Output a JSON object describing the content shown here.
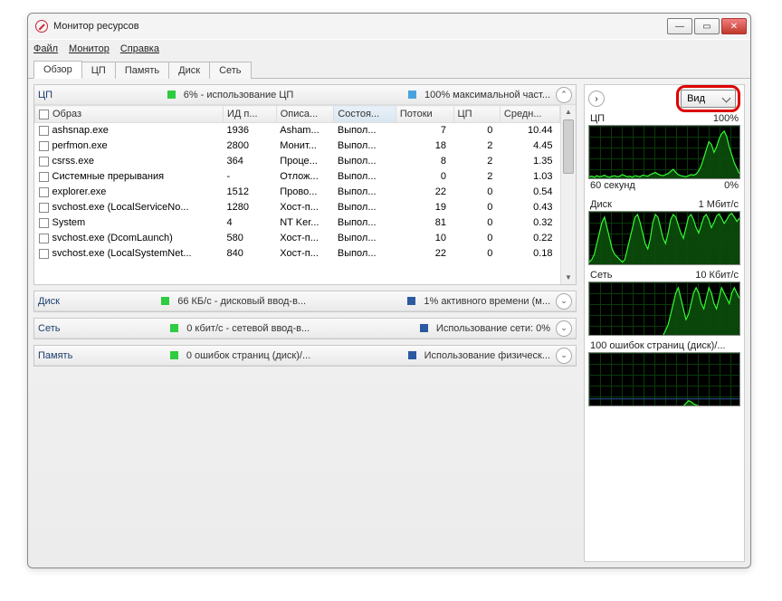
{
  "window": {
    "title": "Монитор ресурсов"
  },
  "menu": {
    "file": "Файл",
    "monitor": "Монитор",
    "help": "Справка"
  },
  "tabs": [
    "Обзор",
    "ЦП",
    "Память",
    "Диск",
    "Сеть"
  ],
  "active_tab": 0,
  "cpu_section": {
    "title": "ЦП",
    "stat1": "6% - использование ЦП",
    "stat2": "100% максимальной част...",
    "columns": [
      "Образ",
      "ИД п...",
      "Описа...",
      "Состоя...",
      "Потоки",
      "ЦП",
      "Средн..."
    ],
    "rows": [
      {
        "name": "ashsnap.exe",
        "pid": "1936",
        "desc": "Asham...",
        "state": "Выпол...",
        "threads": 7,
        "cpu": 0,
        "avg": "10.44"
      },
      {
        "name": "perfmon.exe",
        "pid": "2800",
        "desc": "Монит...",
        "state": "Выпол...",
        "threads": 18,
        "cpu": 2,
        "avg": "4.45"
      },
      {
        "name": "csrss.exe",
        "pid": "364",
        "desc": "Проце...",
        "state": "Выпол...",
        "threads": 8,
        "cpu": 2,
        "avg": "1.35"
      },
      {
        "name": "Системные прерывания",
        "pid": "-",
        "desc": "Отлож...",
        "state": "Выпол...",
        "threads": 0,
        "cpu": 2,
        "avg": "1.03"
      },
      {
        "name": "explorer.exe",
        "pid": "1512",
        "desc": "Прово...",
        "state": "Выпол...",
        "threads": 22,
        "cpu": 0,
        "avg": "0.54"
      },
      {
        "name": "svchost.exe (LocalServiceNo...",
        "pid": "1280",
        "desc": "Хост-п...",
        "state": "Выпол...",
        "threads": 19,
        "cpu": 0,
        "avg": "0.43"
      },
      {
        "name": "System",
        "pid": "4",
        "desc": "NT Ker...",
        "state": "Выпол...",
        "threads": 81,
        "cpu": 0,
        "avg": "0.32"
      },
      {
        "name": "svchost.exe (DcomLaunch)",
        "pid": "580",
        "desc": "Хост-п...",
        "state": "Выпол...",
        "threads": 10,
        "cpu": 0,
        "avg": "0.22"
      },
      {
        "name": "svchost.exe (LocalSystemNet...",
        "pid": "840",
        "desc": "Хост-п...",
        "state": "Выпол...",
        "threads": 22,
        "cpu": 0,
        "avg": "0.18"
      }
    ]
  },
  "disk_section": {
    "title": "Диск",
    "stat1": "66 КБ/с - дисковый ввод-в...",
    "stat2": "1% активного времени (м..."
  },
  "net_section": {
    "title": "Сеть",
    "stat1": "0 кбит/с - сетевой ввод-в...",
    "stat2": "Использование сети: 0%"
  },
  "mem_section": {
    "title": "Память",
    "stat1": "0 ошибок страниц (диск)/...",
    "stat2": "Использование физическ..."
  },
  "view_button": "Вид",
  "graphs": {
    "cpu": {
      "label": "ЦП",
      "top": "100%",
      "foot_l": "60 секунд",
      "foot_r": "0%"
    },
    "disk": {
      "label": "Диск",
      "top": "1 Мбит/с"
    },
    "net": {
      "label": "Сеть",
      "top": "10 Кбит/с"
    },
    "mem": {
      "label": "100 ошибок страниц (диск)/..."
    }
  },
  "chart_data": [
    {
      "type": "line",
      "title": "ЦП",
      "ylabel": "%",
      "ylim": [
        0,
        100
      ],
      "x_window_seconds": 60,
      "series": [
        {
          "name": "ЦП",
          "values": [
            4,
            5,
            3,
            6,
            4,
            5,
            7,
            4,
            3,
            5,
            6,
            4,
            5,
            8,
            6,
            4,
            5,
            3,
            6,
            5,
            4,
            7,
            6,
            5,
            8,
            10,
            12,
            9,
            7,
            6,
            8,
            10,
            14,
            18,
            12,
            8,
            6,
            5,
            4,
            6,
            8,
            7,
            9,
            15,
            25,
            40,
            55,
            70,
            65,
            50,
            60,
            75,
            85,
            90,
            80,
            60,
            45,
            30,
            20,
            10
          ]
        }
      ]
    },
    {
      "type": "line",
      "title": "Диск",
      "ylabel": "Мбит/с",
      "ylim": [
        0,
        1
      ],
      "x_window_seconds": 60,
      "series": [
        {
          "name": "Диск",
          "values": [
            0.05,
            0.1,
            0.2,
            0.4,
            0.6,
            0.8,
            0.9,
            0.7,
            0.5,
            0.3,
            0.2,
            0.15,
            0.1,
            0.05,
            0.1,
            0.3,
            0.5,
            0.7,
            0.9,
            0.95,
            0.8,
            0.6,
            0.4,
            0.3,
            0.5,
            0.8,
            0.95,
            0.9,
            0.7,
            0.5,
            0.4,
            0.6,
            0.85,
            0.95,
            0.9,
            0.75,
            0.6,
            0.5,
            0.7,
            0.9,
            0.95,
            0.85,
            0.7,
            0.6,
            0.75,
            0.9,
            0.95,
            0.85,
            0.7,
            0.8,
            0.92,
            0.96,
            0.88,
            0.78,
            0.85,
            0.94,
            0.97,
            0.9,
            0.82,
            0.88
          ]
        }
      ]
    },
    {
      "type": "line",
      "title": "Сеть",
      "ylabel": "Кбит/с",
      "ylim": [
        0,
        10
      ],
      "x_window_seconds": 60,
      "series": [
        {
          "name": "Сеть",
          "values": [
            0,
            0,
            0,
            0,
            0,
            0,
            0,
            0,
            0,
            0,
            0,
            0,
            0,
            0,
            0,
            0,
            0,
            0,
            0,
            0,
            0,
            0,
            0,
            0,
            0,
            0,
            0,
            0,
            0,
            0,
            1,
            2,
            4,
            6,
            8,
            9,
            7,
            5,
            3,
            4,
            6,
            8,
            9,
            8,
            6,
            5,
            7,
            9,
            8,
            6,
            5,
            7,
            9,
            8,
            7,
            6,
            8,
            9,
            8,
            7
          ]
        }
      ]
    },
    {
      "type": "line",
      "title": "Ошибки страниц (диск)",
      "ylabel": "ошибок/с",
      "ylim": [
        0,
        100
      ],
      "x_window_seconds": 60,
      "series": [
        {
          "name": "ошибок",
          "values": [
            0,
            0,
            0,
            0,
            0,
            0,
            0,
            0,
            0,
            0,
            0,
            0,
            0,
            0,
            0,
            0,
            0,
            0,
            0,
            0,
            0,
            0,
            0,
            0,
            0,
            0,
            0,
            0,
            0,
            0,
            0,
            0,
            0,
            0,
            0,
            0,
            0,
            0,
            5,
            10,
            8,
            4,
            2,
            0,
            0,
            0,
            0,
            0,
            0,
            0,
            0,
            0,
            0,
            0,
            0,
            0,
            0,
            0,
            0,
            0
          ]
        }
      ]
    }
  ]
}
